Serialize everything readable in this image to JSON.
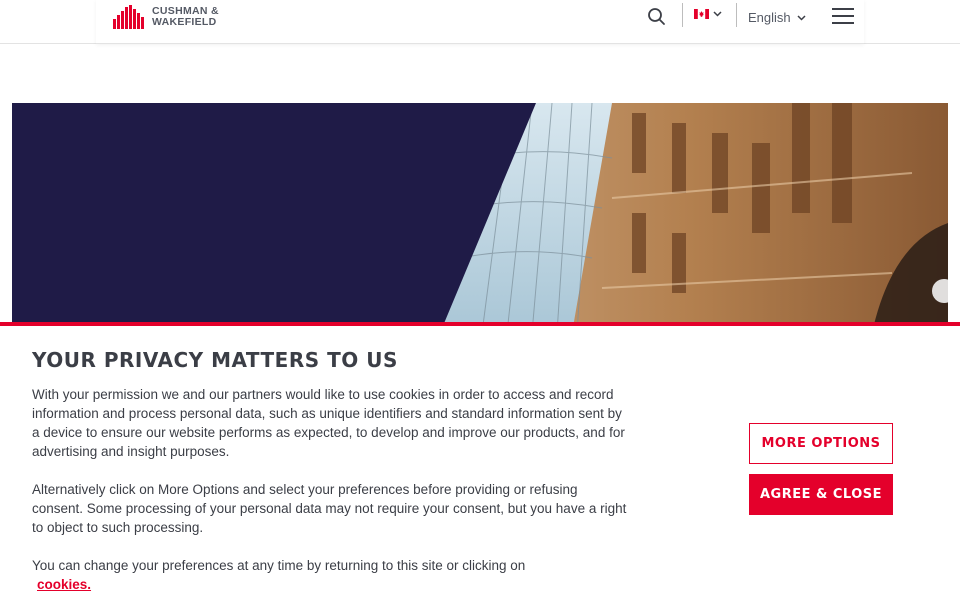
{
  "header": {
    "logo_line1": "CUSHMAN &",
    "logo_line2": "WAKEFIELD",
    "language": "English",
    "country_flag": "canada-flag"
  },
  "cookie_banner": {
    "title": "YOUR PRIVACY MATTERS TO US",
    "paragraph1": "With your permission we and our partners would like to use cookies in order to access and record information and process personal data, such as unique identifiers and standard information sent by a device to ensure our website performs as expected, to develop and improve our products, and for advertising and insight purposes.",
    "paragraph2": "Alternatively click on More Options and select your preferences before providing or refusing consent. Some processing of your personal data may not require your consent, but you have a right to object to such processing.",
    "paragraph3": "You can change your preferences at any time by returning to this site or clicking on",
    "link_label": "cookies.",
    "more_options_label": "MORE OPTIONS",
    "agree_label": "AGREE & CLOSE"
  },
  "colors": {
    "brand_red": "#e4002b",
    "navy": "#1f1b47",
    "text": "#3b3e46"
  }
}
